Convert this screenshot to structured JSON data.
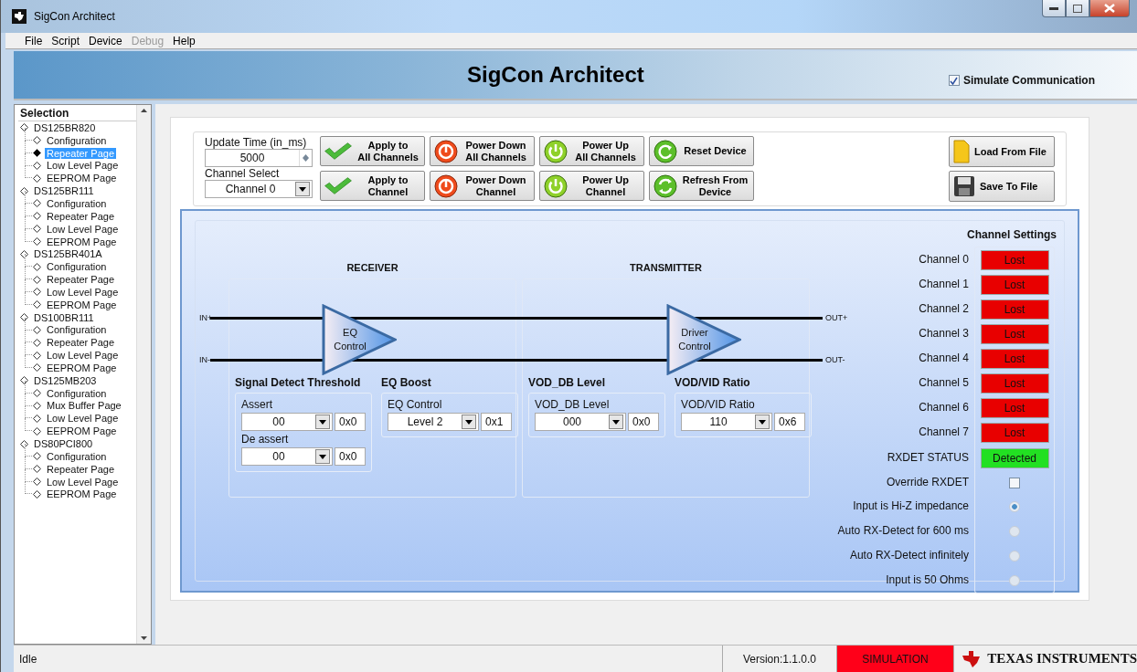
{
  "window": {
    "title": "SigCon Architect"
  },
  "menu": [
    {
      "label": "File",
      "disabled": false
    },
    {
      "label": "Script",
      "disabled": false
    },
    {
      "label": "Device",
      "disabled": false
    },
    {
      "label": "Debug",
      "disabled": true
    },
    {
      "label": "Help",
      "disabled": false
    }
  ],
  "banner": {
    "title": "SigCon Architect",
    "simulate": {
      "label": "Simulate Communication",
      "checked": true
    }
  },
  "sidebar": {
    "heading": "Selection",
    "devices": [
      {
        "label": "DS125BR820",
        "children": [
          {
            "label": "Configuration",
            "selected": false
          },
          {
            "label": "Repeater Page",
            "selected": true
          },
          {
            "label": "Low Level Page",
            "selected": false
          },
          {
            "label": "EEPROM Page",
            "selected": false
          }
        ]
      },
      {
        "label": "DS125BR111",
        "children": [
          {
            "label": "Configuration",
            "selected": false
          },
          {
            "label": "Repeater Page",
            "selected": false
          },
          {
            "label": "Low Level Page",
            "selected": false
          },
          {
            "label": "EEPROM Page",
            "selected": false
          }
        ]
      },
      {
        "label": "DS125BR401A",
        "children": [
          {
            "label": "Configuration",
            "selected": false
          },
          {
            "label": "Repeater Page",
            "selected": false
          },
          {
            "label": "Low Level Page",
            "selected": false
          },
          {
            "label": "EEPROM Page",
            "selected": false
          }
        ]
      },
      {
        "label": "DS100BR111",
        "children": [
          {
            "label": "Configuration",
            "selected": false
          },
          {
            "label": "Repeater Page",
            "selected": false
          },
          {
            "label": "Low Level Page",
            "selected": false
          },
          {
            "label": "EEPROM Page",
            "selected": false
          }
        ]
      },
      {
        "label": "DS125MB203",
        "children": [
          {
            "label": "Configuration",
            "selected": false
          },
          {
            "label": "Mux Buffer Page",
            "selected": false
          },
          {
            "label": "Low Level Page",
            "selected": false
          },
          {
            "label": "EEPROM Page",
            "selected": false
          }
        ]
      },
      {
        "label": "DS80PCI800",
        "children": [
          {
            "label": "Configuration",
            "selected": false
          },
          {
            "label": "Repeater Page",
            "selected": false
          },
          {
            "label": "Low Level Page",
            "selected": false
          },
          {
            "label": "EEPROM Page",
            "selected": false
          }
        ]
      }
    ]
  },
  "controls": {
    "update_time": {
      "label": "Update Time (in_ms)",
      "value": "5000"
    },
    "channel_select": {
      "label": "Channel Select",
      "value": "Channel 0"
    }
  },
  "buttons": [
    {
      "label": "Apply to\nAll Channels",
      "kind": "check"
    },
    {
      "label": "Power Down\nAll Channels",
      "kind": "power_down"
    },
    {
      "label": "Power Up\nAll Channels",
      "kind": "power_up"
    },
    {
      "label": "Reset Device",
      "kind": "reset"
    },
    {
      "label": "Apply to\nChannel",
      "kind": "check"
    },
    {
      "label": "Power Down\nChannel",
      "kind": "power_down"
    },
    {
      "label": "Power Up\nChannel",
      "kind": "power_up"
    },
    {
      "label": "Refresh From\nDevice",
      "kind": "refresh"
    }
  ],
  "file_buttons": [
    {
      "label": "Load From File",
      "kind": "load"
    },
    {
      "label": "Save To File",
      "kind": "save"
    }
  ],
  "diagram": {
    "inputs": [
      "IN+",
      "IN-"
    ],
    "outputs": [
      "OUT+",
      "OUT-"
    ],
    "sections": [
      {
        "title": "RECEIVER",
        "amplifier": "EQ\nControl",
        "groups": [
          {
            "title": "Signal Detect Threshold",
            "fields": [
              {
                "label": "Assert",
                "value": "00",
                "hex": "0x0"
              },
              {
                "label": "De assert",
                "value": "00",
                "hex": "0x0"
              }
            ]
          },
          {
            "title": "EQ Boost",
            "fields": [
              {
                "label": "EQ Control",
                "value": "Level 2",
                "hex": "0x1"
              }
            ]
          }
        ]
      },
      {
        "title": "TRANSMITTER",
        "amplifier": "Driver\nControl",
        "groups": [
          {
            "title": "VOD_DB Level",
            "fields": [
              {
                "label": "VOD_DB Level",
                "value": "000",
                "hex": "0x0"
              }
            ]
          },
          {
            "title": "VOD/VID Ratio",
            "fields": [
              {
                "label": "VOD/VID Ratio",
                "value": "110",
                "hex": "0x6"
              }
            ]
          }
        ]
      }
    ]
  },
  "channel_settings": {
    "title": "Channel Settings",
    "channels": [
      {
        "label": "Channel 0",
        "status": "Lost",
        "color": "#e80000"
      },
      {
        "label": "Channel 1",
        "status": "Lost",
        "color": "#e80000"
      },
      {
        "label": "Channel 2",
        "status": "Lost",
        "color": "#e80000"
      },
      {
        "label": "Channel 3",
        "status": "Lost",
        "color": "#e80000"
      },
      {
        "label": "Channel 4",
        "status": "Lost",
        "color": "#e80000"
      },
      {
        "label": "Channel 5",
        "status": "Lost",
        "color": "#e80000"
      },
      {
        "label": "Channel 6",
        "status": "Lost",
        "color": "#e80000"
      },
      {
        "label": "Channel 7",
        "status": "Lost",
        "color": "#e80000"
      }
    ],
    "rxdet": {
      "label": "RXDET STATUS",
      "status": "Detected",
      "color": "#22e022"
    },
    "override": {
      "label": "Override RXDET",
      "checked": false
    },
    "modes": [
      {
        "label": "Input is Hi-Z impedance",
        "selected": true
      },
      {
        "label": "Auto RX-Detect for 600 ms",
        "selected": false
      },
      {
        "label": "Auto RX-Detect infinitely",
        "selected": false
      },
      {
        "label": "Input is 50 Ohms",
        "selected": false
      }
    ]
  },
  "status_bar": {
    "status": "Idle",
    "version": "Version:1.1.0.0",
    "mode": "SIMULATION",
    "brand": "TEXAS INSTRUMENTS"
  }
}
